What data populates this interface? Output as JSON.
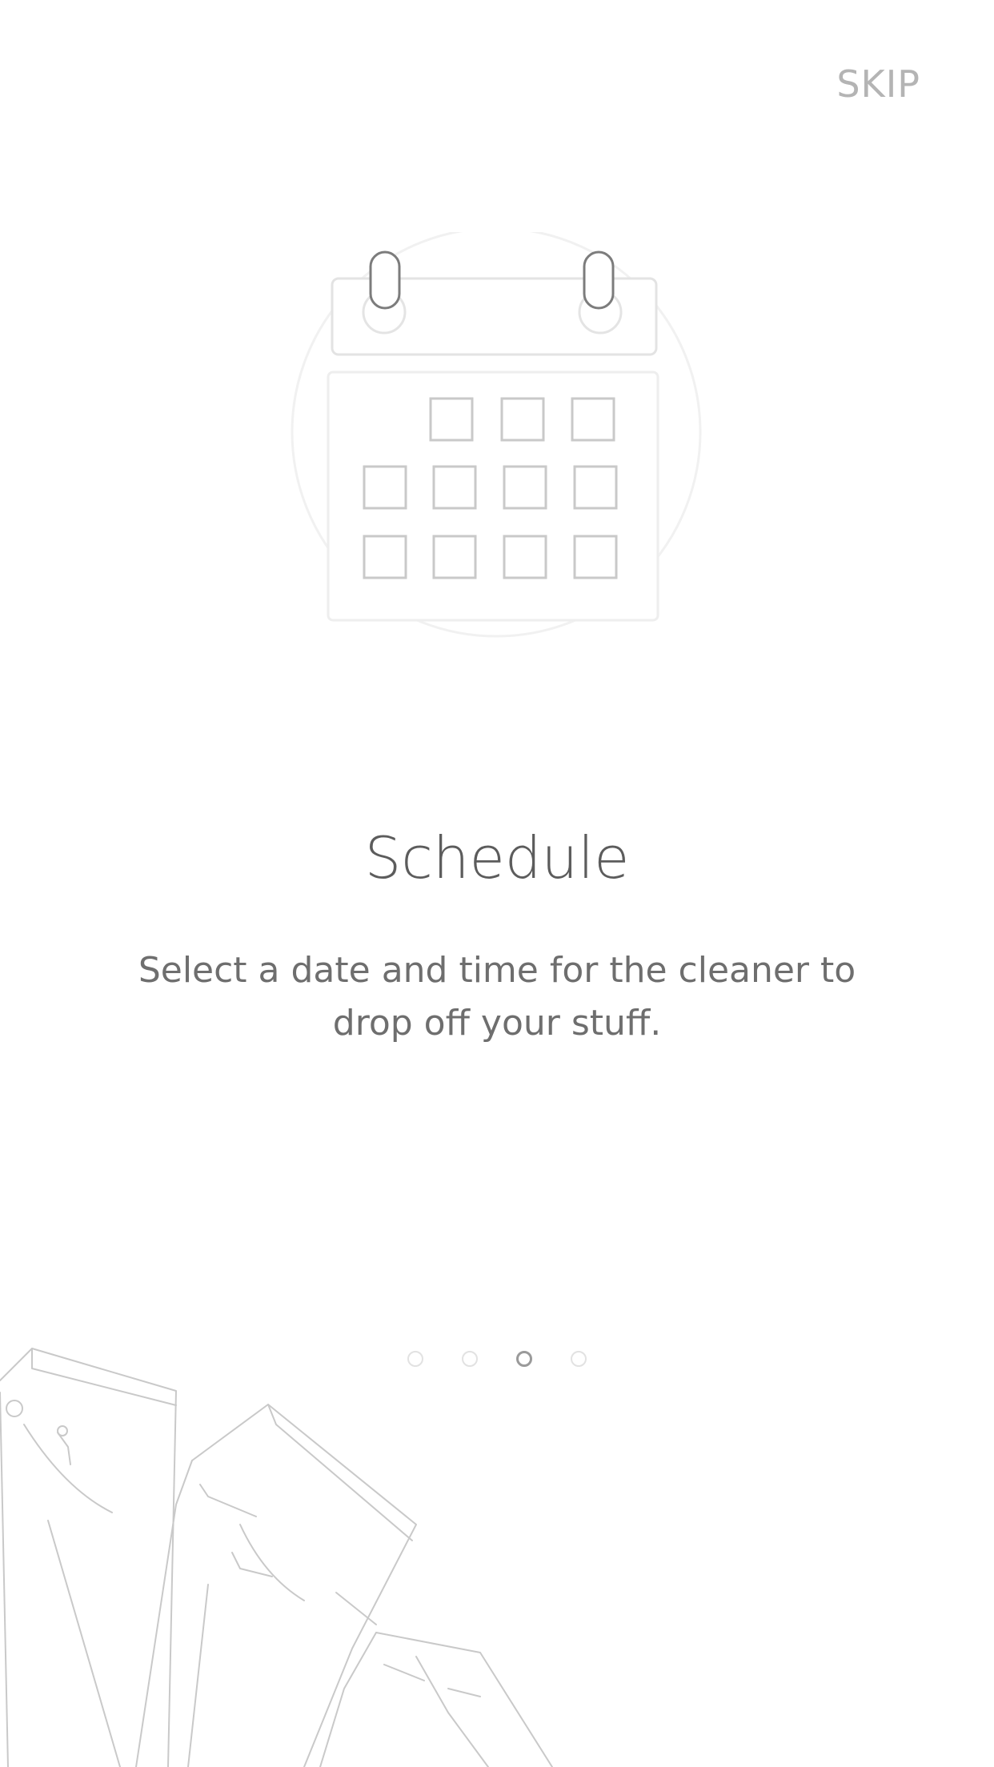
{
  "header": {
    "skip_label": "SKIP"
  },
  "slide": {
    "icon": "calendar-icon",
    "title": "Schedule",
    "description": "Select a date and time for the cleaner to drop off your stuff."
  },
  "pagination": {
    "total": 4,
    "active_index": 2
  },
  "decoration": {
    "image": "jeans-illustration"
  },
  "colors": {
    "background": "#ffffff",
    "title": "#5c5c5c",
    "text": "#6e6e6e",
    "skip": "#b4b4b4",
    "dot_inactive": "#e2e2e2",
    "dot_active": "#9a9a9a"
  }
}
